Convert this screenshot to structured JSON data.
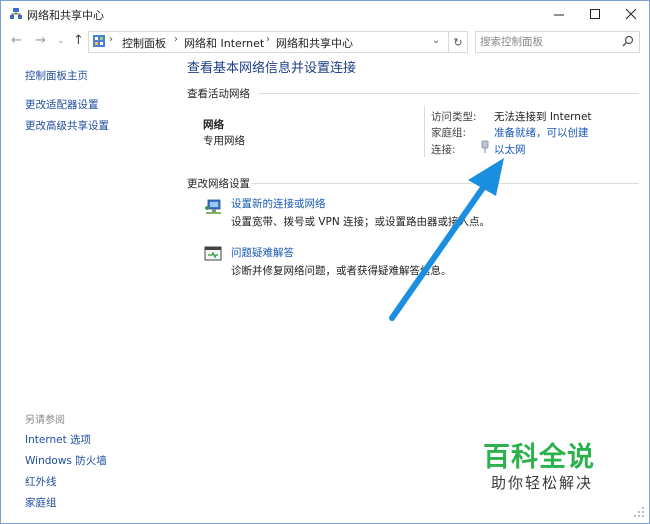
{
  "window": {
    "title": "网络和共享中心"
  },
  "address": {
    "crumbs": [
      "控制面板",
      "网络和 Internet",
      "网络和共享中心"
    ],
    "search_placeholder": "搜索控制面板"
  },
  "sidebar": {
    "items": [
      {
        "label": "控制面板主页"
      },
      {
        "label": "更改适配器设置"
      },
      {
        "label": "更改高级共享设置"
      }
    ],
    "see_also_title": "另请参阅",
    "see_also": [
      {
        "label": "Internet 选项"
      },
      {
        "label": "Windows 防火墙"
      },
      {
        "label": "红外线"
      },
      {
        "label": "家庭组"
      }
    ]
  },
  "main": {
    "heading": "查看基本网络信息并设置连接",
    "active_title": "查看活动网络",
    "network": {
      "name": "网络",
      "type": "专用网络"
    },
    "access_type_label": "访问类型:",
    "access_type_value": "无法连接到 Internet",
    "homegroup_label": "家庭组:",
    "homegroup_value": "准备就绪，可以创建",
    "connection_label": "连接:",
    "connection_value": "以太网",
    "change_title": "更改网络设置",
    "tasks": [
      {
        "title": "设置新的连接或网络",
        "desc": "设置宽带、拨号或 VPN 连接；或设置路由器或接入点。"
      },
      {
        "title": "问题疑难解答",
        "desc": "诊断并修复网络问题，或者获得疑难解答信息。"
      }
    ]
  },
  "watermark": {
    "line1": "百科全说",
    "line2": "助你轻松解决"
  },
  "colors": {
    "link": "#1a5bb5",
    "heading": "#1e3f87",
    "arrow": "#1a8fe0",
    "watermark": "#2bb24c"
  }
}
